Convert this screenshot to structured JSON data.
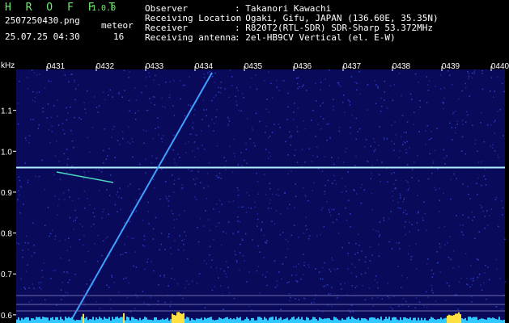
{
  "app": {
    "name": "H R O F F T",
    "version": "1.0.0"
  },
  "file": {
    "name": "2507250430.png",
    "timestamp": "25.07.25 04:30"
  },
  "detection": {
    "label": "meteor",
    "count": "16"
  },
  "station": {
    "observer_label": "Observer",
    "observer": ": Takanori Kawachi",
    "location_label": "Receiving Location",
    "location": ": Ogaki, Gifu, JAPAN (136.60E, 35.35N)",
    "receiver_label": "Receiver",
    "receiver": ": R820T2(RTL-SDR) SDR-Sharp 53.372MHz",
    "antenna_label": "Receiving antenna",
    "antenna": ": 2el-HB9CV Vertical (el. E-W)"
  },
  "chart_data": {
    "type": "heatmap",
    "ylabel": "kHz",
    "x_ticks": [
      "0431",
      "0432",
      "0433",
      "0434",
      "0435",
      "0436",
      "0437",
      "0438",
      "0439",
      "0440"
    ],
    "y_ticks": [
      "1.1",
      "1.0",
      "0.9",
      "0.8",
      "0.7",
      "0.6"
    ],
    "ylim": [
      0.58,
      1.2
    ],
    "carrier_khz": 0.96,
    "colors": {
      "background": "#0a0a5a",
      "signal": "#40a0ff",
      "carrier": "#b0f0ff",
      "axis": "#000000",
      "tick_text": "#ffffff",
      "level_bar": "#30c8ff"
    }
  }
}
